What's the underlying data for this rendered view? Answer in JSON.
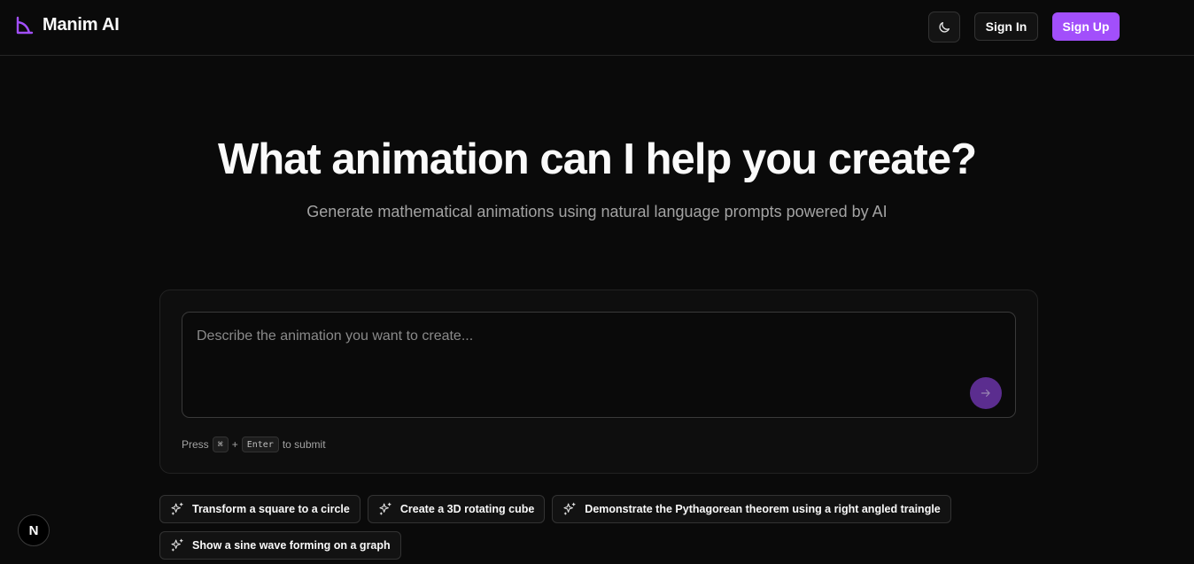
{
  "header": {
    "brand_name": "Manim AI",
    "logo_icon": "manim-logo-icon",
    "theme_toggle_icon": "moon-icon",
    "sign_in_label": "Sign In",
    "sign_up_label": "Sign Up"
  },
  "hero": {
    "title": "What animation can I help you create?",
    "subtitle": "Generate mathematical animations using natural language prompts powered by AI"
  },
  "prompt": {
    "placeholder": "Describe the animation you want to create...",
    "value": "",
    "submit_icon": "arrow-right-icon",
    "hint_prefix": "Press",
    "hint_key_cmd": "⌘",
    "hint_plus": "+",
    "hint_key_enter": "Enter",
    "hint_suffix": "to submit"
  },
  "suggestions": [
    {
      "label": "Transform a square to a circle",
      "icon": "sparkles-icon"
    },
    {
      "label": "Create a 3D rotating cube",
      "icon": "sparkles-icon"
    },
    {
      "label": "Demonstrate the Pythagorean theorem using a right angled traingle",
      "icon": "sparkles-icon"
    },
    {
      "label": "Show a sine wave forming on a graph",
      "icon": "sparkles-icon"
    }
  ],
  "dev_badge": {
    "label": "N"
  },
  "colors": {
    "background": "#0a0a0a",
    "accent": "#a24ffb",
    "submit_button": "#5b2d8f",
    "border": "#333333",
    "muted_text": "#a3a3a3"
  }
}
